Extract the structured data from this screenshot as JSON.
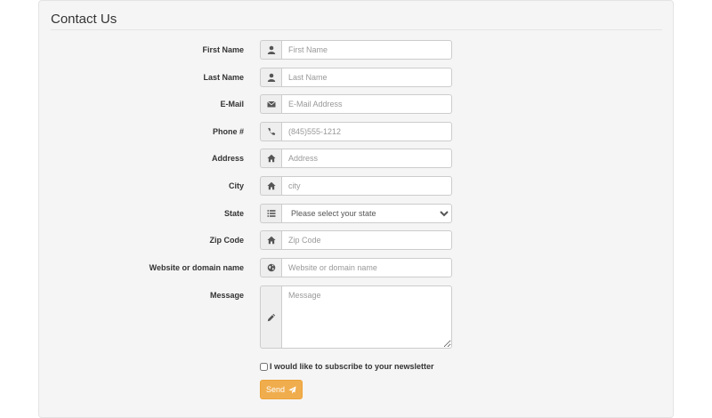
{
  "form": {
    "legend": "Contact Us",
    "fields": {
      "first_name": {
        "label": "First Name",
        "placeholder": "First Name",
        "icon": "user-icon"
      },
      "last_name": {
        "label": "Last Name",
        "placeholder": "Last Name",
        "icon": "user-icon"
      },
      "email": {
        "label": "E-Mail",
        "placeholder": "E-Mail Address",
        "icon": "envelope-icon"
      },
      "phone": {
        "label": "Phone #",
        "placeholder": "(845)555-1212",
        "icon": "phone-icon"
      },
      "address": {
        "label": "Address",
        "placeholder": "Address",
        "icon": "home-icon"
      },
      "city": {
        "label": "City",
        "placeholder": "city",
        "icon": "home-icon"
      },
      "state": {
        "label": "State",
        "selected": "Please select your state",
        "icon": "list-icon"
      },
      "zip": {
        "label": "Zip Code",
        "placeholder": "Zip Code",
        "icon": "home-icon"
      },
      "website": {
        "label": "Website or domain name",
        "placeholder": "Website or domain name",
        "icon": "globe-icon"
      },
      "message": {
        "label": "Message",
        "placeholder": "Message",
        "icon": "pencil-icon"
      }
    },
    "newsletter_label": "I would like to subscribe to your newsletter",
    "send_label": "Send",
    "send_icon": "send-icon"
  },
  "colors": {
    "panel_bg": "#f5f5f5",
    "addon_bg": "#eeeeee",
    "send_bg": "#f0ad4e",
    "placeholder": "#999999"
  }
}
